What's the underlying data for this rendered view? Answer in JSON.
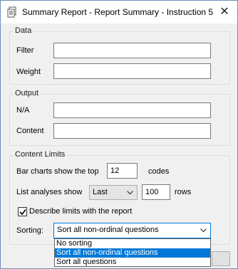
{
  "window": {
    "title": "Summary Report - Report Summary - Instruction 5",
    "close_symbol": "✕"
  },
  "data_group": {
    "legend": "Data",
    "filter_label": "Filter",
    "filter_value": "",
    "weight_label": "Weight",
    "weight_value": ""
  },
  "output_group": {
    "legend": "Output",
    "na_label": "N/A",
    "na_value": "",
    "content_label": "Content",
    "content_value": ""
  },
  "limits_group": {
    "legend": "Content Limits",
    "bar_label": "Bar charts show the top",
    "bar_value": "12",
    "bar_unit": "codes",
    "list_label": "List analyses show",
    "list_mode": "Last",
    "list_value": "100",
    "list_unit": "rows",
    "describe_label": "Describe limits with the report",
    "describe_checked": true,
    "sorting_label": "Sorting:",
    "sorting_value": "Sort all non-ordinal questions",
    "sorting_options": [
      "No sorting",
      "Sort all non-ordinal questions",
      "Sort all questions"
    ]
  },
  "colors": {
    "accent": "#0078d7",
    "window_bg": "#f0f0f0",
    "border": "#6d8fb8"
  },
  "icons": {
    "app": "report-icon",
    "close": "close-icon",
    "chevron": "chevron-down-icon",
    "check": "check-icon"
  }
}
